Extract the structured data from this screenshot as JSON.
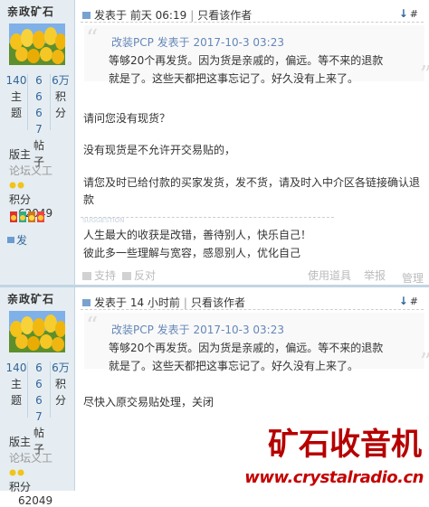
{
  "posts": [
    {
      "author": {
        "name": "亲政矿石",
        "stats": [
          {
            "value": "140",
            "label": "主题"
          },
          {
            "value": "6667",
            "label": "帖子"
          },
          {
            "value": "6万",
            "label": "积分"
          }
        ],
        "group": "版主",
        "subtitle": "论坛义工",
        "score_label": "积分",
        "score_value": "62049",
        "pm_label": "发"
      },
      "meta": {
        "posted": "发表于 前天 06:19",
        "separator": "|",
        "only_author": "只看该作者"
      },
      "floor": "#",
      "quote": {
        "head": "改装PCP 发表于 2017-10-3 03:23",
        "lines": [
          "等够20个再发货。因为货是亲戚的，偏远。等不来的退款",
          "就是了。这些天都把这事忘记了。好久没有上来了。"
        ]
      },
      "body": [
        "请问您没有现货？",
        "没有现货是不允许开交易贴的，",
        "请您及时已给付款的买家发货，发不货，请及时入中介区各链接确认退",
        "款"
      ],
      "signature_tag": "SUGGESTION",
      "signature": [
        "人生最大的收获是改错，善待别人，快乐自己！",
        "彼此多一些理解与宽容，感恩别人，优化自己"
      ],
      "actions": {
        "support": "支持",
        "oppose": "反对",
        "tools": "使用道具",
        "report": "举报",
        "manage": "管理"
      }
    },
    {
      "author": {
        "name": "亲政矿石",
        "stats": [
          {
            "value": "140",
            "label": "主题"
          },
          {
            "value": "6667",
            "label": "帖子"
          },
          {
            "value": "6万",
            "label": "积分"
          }
        ],
        "group": "版主",
        "subtitle": "论坛义工",
        "score_label": "积分",
        "score_value": "62049"
      },
      "meta": {
        "posted": "发表于 14 小时前",
        "separator": "|",
        "only_author": "只看该作者"
      },
      "floor": "#",
      "quote": {
        "head": "改装PCP 发表于 2017-10-3 03:23",
        "lines": [
          "等够20个再发货。因为货是亲戚的，偏远。等不来的退款",
          "就是了。这些天都把这事忘记了。好久没有上来了。"
        ]
      },
      "body": [
        "尽快入原交易贴处理，关闭"
      ]
    }
  ],
  "watermark": {
    "logo": "矿石收音机",
    "url": "www.crystalradio.cn"
  },
  "colors": {
    "sidebar": "#e5edf2",
    "border": "#c2d5e3",
    "link": "#336699",
    "quote_head": "#6487b8",
    "watermark": "#b50000"
  }
}
